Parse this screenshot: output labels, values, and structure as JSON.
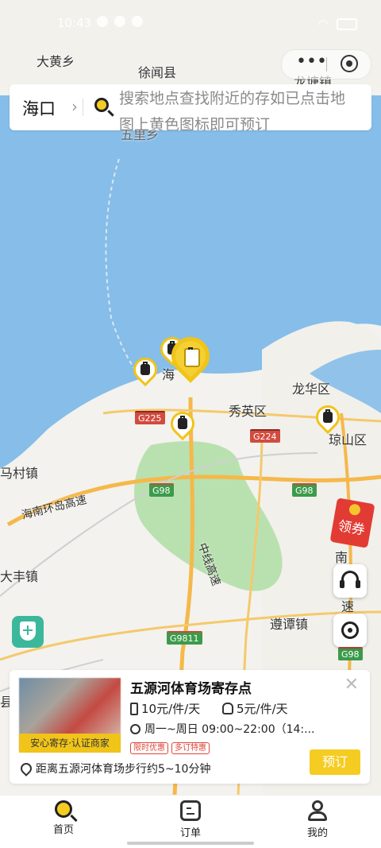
{
  "status_bar": {
    "time": "10:43"
  },
  "search": {
    "city": "海口",
    "hint": "搜索地点查找附近的存如已点击地图上黄色图标即可预订"
  },
  "map": {
    "labels": {
      "dahuang": "大黄乡",
      "xuwen": "徐闻县",
      "longtang": "龙塘镇",
      "wuli": "五里乡",
      "hai": "海",
      "longhua": "龙华区",
      "xiuying": "秀英区",
      "qiongshan": "琼山区",
      "macun": "马村镇",
      "huandao": "海南环岛高速",
      "dafeng": "大丰镇",
      "zhongxian": "中线高速",
      "zuntan": "遵谭镇",
      "nan": "南",
      "su": "速",
      "xian": "县"
    },
    "routes": {
      "g225": "G225",
      "g224": "G224",
      "g98a": "G98",
      "g98b": "G98",
      "g98c": "G98",
      "g9811": "G9811"
    },
    "coupon_label": "领券"
  },
  "store_card": {
    "title": "五源河体育场寄存点",
    "badge": "安心寄存·认证商家",
    "price_luggage": "10元/件/天",
    "price_bag": "5元/件/天",
    "hours": "周一~周日 09:00~22:00（14:...",
    "tags": [
      "限时优惠",
      "多订特惠"
    ],
    "distance": "距离五源河体育场步行约5~10分钟",
    "book_label": "预订"
  },
  "tabs": [
    {
      "label": "首页"
    },
    {
      "label": "订单"
    },
    {
      "label": "我的"
    }
  ]
}
